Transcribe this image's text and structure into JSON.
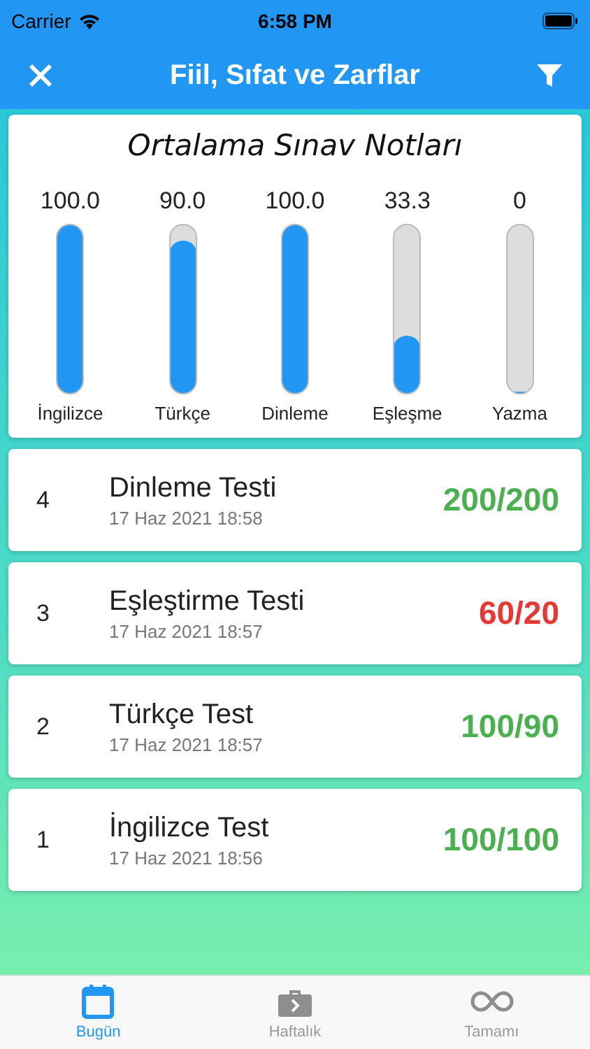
{
  "status_bar": {
    "carrier": "Carrier",
    "time": "6:58 PM"
  },
  "nav": {
    "title": "Fiil, Sıfat ve Zarflar"
  },
  "averages": {
    "title": "Ortalama Sınav Notları",
    "meters": [
      {
        "label": "İngilizce",
        "reading": "100.0",
        "level": 1
      },
      {
        "label": "Türkçe",
        "reading": "90.0",
        "level": 0.9
      },
      {
        "label": "Dinleme",
        "reading": "100.0",
        "level": 1
      },
      {
        "label": "Eşleşme",
        "reading": "33.3",
        "level": 0.333
      },
      {
        "label": "Yazma",
        "reading": "0",
        "level": 0
      }
    ]
  },
  "results": [
    {
      "number": "4",
      "title": "Dinleme Testi",
      "date": "17 Haz 2021 18:58",
      "score": "200/200",
      "color": "#4caf50"
    },
    {
      "number": "3",
      "title": "Eşleştirme Testi",
      "date": "17 Haz 2021 18:57",
      "score": "60/20",
      "color": "#e53935"
    },
    {
      "number": "2",
      "title": "Türkçe Test",
      "date": "17 Haz 2021 18:57",
      "score": "100/90",
      "color": "#4caf50"
    },
    {
      "number": "1",
      "title": "İngilizce Test",
      "date": "17 Haz 2021 18:56",
      "score": "100/100",
      "color": "#4caf50"
    }
  ],
  "tabs": [
    {
      "label": "Bugün",
      "selected": true,
      "kind": "calendar"
    },
    {
      "label": "Haftalık",
      "selected": false,
      "kind": "briefcase"
    },
    {
      "label": "Tamamı",
      "selected": false,
      "kind": "infinity"
    }
  ]
}
